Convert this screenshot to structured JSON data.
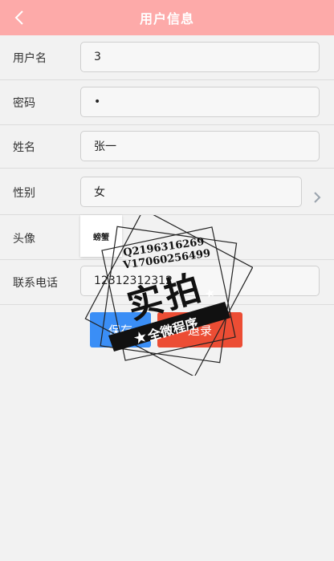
{
  "header": {
    "title": "用户信息",
    "back_icon": "chevron-left-icon"
  },
  "form": {
    "username": {
      "label": "用户名",
      "value": "3"
    },
    "password": {
      "label": "密码",
      "value": "•"
    },
    "realname": {
      "label": "姓名",
      "value": "张一"
    },
    "gender": {
      "label": "性别",
      "value": "女",
      "icon": "chevron-right-icon"
    },
    "avatar": {
      "label": "头像",
      "image_text": "螃蟹"
    },
    "phone": {
      "label": "联系电话",
      "value": "12312312312"
    }
  },
  "actions": {
    "save_label": "保存",
    "logout_label": "退录"
  },
  "watermark": {
    "line1": "Q2196316269",
    "line2": "V17060256499",
    "main": "实拍",
    "banner": "全微程序"
  },
  "colors": {
    "header_bg": "#fdaaa9",
    "save_bg": "#3a8ef6",
    "logout_bg": "#ec4d34"
  }
}
